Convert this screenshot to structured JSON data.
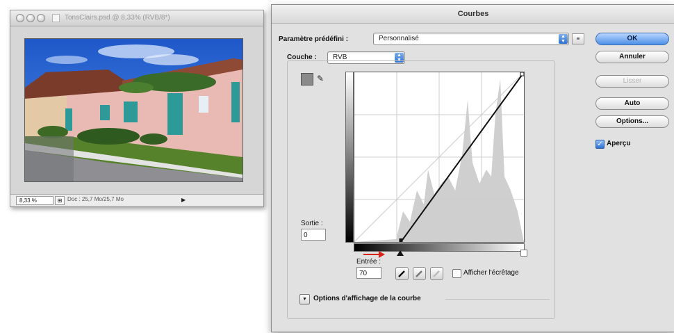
{
  "document_window": {
    "title": "TonsClairs.psd @ 8,33% (RVB/8*)",
    "zoom": "8,33 %",
    "doc_info": "Doc : 25,7 Mo/25,7 Mo"
  },
  "curves_dialog": {
    "title": "Courbes",
    "preset_label": "Paramètre prédéfini :",
    "preset_value": "Personnalisé",
    "channel_label": "Couche :",
    "channel_value": "RVB",
    "output_label": "Sortie :",
    "output_value": "0",
    "input_label": "Entrée :",
    "input_value": "70",
    "show_clipping_label": "Afficher l'écrêtage",
    "curve_display_options_label": "Options d'affichage de la courbe",
    "buttons": {
      "ok": "OK",
      "cancel": "Annuler",
      "smooth": "Lisser",
      "auto": "Auto",
      "options": "Options..."
    },
    "preview_label": "Aperçu",
    "preview_checked": true,
    "curve_points": [
      [
        70,
        0
      ],
      [
        255,
        255
      ]
    ],
    "input_range": [
      0,
      255
    ],
    "output_range": [
      0,
      255
    ],
    "colors": {
      "accent": "#3b7fe0",
      "marker": "#d8241c"
    }
  }
}
